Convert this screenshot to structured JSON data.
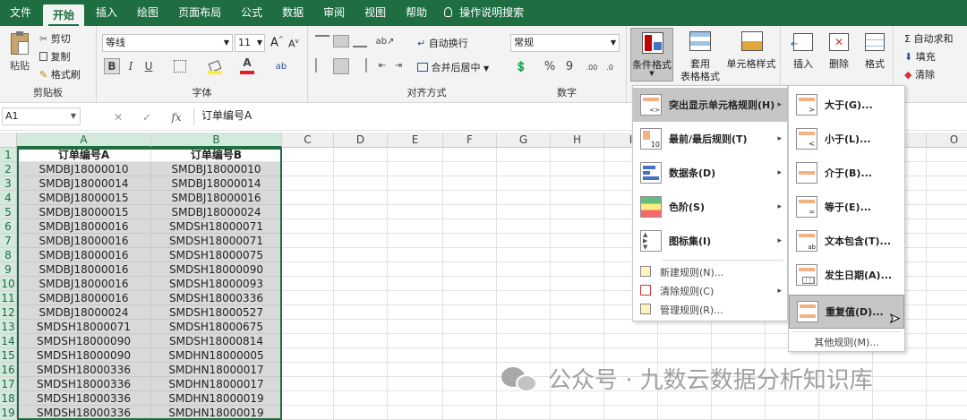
{
  "menubar": {
    "tabs": [
      "文件",
      "开始",
      "插入",
      "绘图",
      "页面布局",
      "公式",
      "数据",
      "审阅",
      "视图",
      "帮助"
    ],
    "active": "开始",
    "tell_me": "操作说明搜索"
  },
  "ribbon": {
    "clipboard": {
      "paste": "粘贴",
      "cut": "剪切",
      "copy": "复制",
      "painter": "格式刷",
      "label": "剪贴板"
    },
    "font": {
      "name": "等线",
      "size": "11",
      "bold": "B",
      "italic": "I",
      "underline": "U",
      "grow": "A",
      "shrink": "A",
      "label": "字体"
    },
    "alignment": {
      "wrap": "自动换行",
      "merge": "合并后居中",
      "label": "对齐方式"
    },
    "number": {
      "format": "常规",
      "percent": "%",
      "comma": "9",
      "label": "数字"
    },
    "styles": {
      "conditional": "条件格式",
      "table_l1": "套用",
      "table_l2": "表格格式",
      "cell_styles": "单元格样式"
    },
    "cells": {
      "insert": "插入",
      "delete": "删除",
      "format": "格式"
    },
    "editing": {
      "autosum": "Σ 自动求和",
      "fill": "填充",
      "clear": "清除"
    }
  },
  "formula_bar": {
    "name_box": "A1",
    "cancel": "✕",
    "enter": "✓",
    "fx": "fx",
    "content": "订单编号A"
  },
  "grid": {
    "columns": [
      "A",
      "B",
      "C",
      "D",
      "E",
      "F",
      "G",
      "H",
      "I",
      "J",
      "K",
      "L",
      "M",
      "N",
      "O"
    ],
    "rows": [
      "1",
      "2",
      "3",
      "4",
      "5",
      "6",
      "7",
      "8",
      "9",
      "10",
      "11",
      "12",
      "13",
      "14",
      "15",
      "16",
      "17",
      "18",
      "19"
    ],
    "header": [
      "订单编号A",
      "订单编号B"
    ],
    "data": [
      [
        "SMDBJ18000010",
        "SMDBJ18000010"
      ],
      [
        "SMDBJ18000014",
        "SMDBJ18000014"
      ],
      [
        "SMDBJ18000015",
        "SMDBJ18000016"
      ],
      [
        "SMDBJ18000015",
        "SMDBJ18000024"
      ],
      [
        "SMDBJ18000016",
        "SMDSH18000071"
      ],
      [
        "SMDBJ18000016",
        "SMDSH18000071"
      ],
      [
        "SMDBJ18000016",
        "SMDSH18000075"
      ],
      [
        "SMDBJ18000016",
        "SMDSH18000090"
      ],
      [
        "SMDBJ18000016",
        "SMDSH18000093"
      ],
      [
        "SMDBJ18000016",
        "SMDSH18000336"
      ],
      [
        "SMDBJ18000024",
        "SMDSH18000527"
      ],
      [
        "SMDSH18000071",
        "SMDSH18000675"
      ],
      [
        "SMDSH18000090",
        "SMDSH18000814"
      ],
      [
        "SMDSH18000090",
        "SMDHN18000005"
      ],
      [
        "SMDSH18000336",
        "SMDHN18000017"
      ],
      [
        "SMDSH18000336",
        "SMDHN18000017"
      ],
      [
        "SMDSH18000336",
        "SMDHN18000019"
      ],
      [
        "SMDSH18000336",
        "SMDHN18000019"
      ]
    ]
  },
  "cf_menu": {
    "items": [
      {
        "label": "突出显示单元格规则(H)",
        "has_sub": true
      },
      {
        "label": "最前/最后规则(T)",
        "has_sub": true
      },
      {
        "label": "数据条(D)",
        "has_sub": true
      },
      {
        "label": "色阶(S)",
        "has_sub": true
      },
      {
        "label": "图标集(I)",
        "has_sub": true
      }
    ],
    "actions": [
      {
        "label": "新建规则(N)..."
      },
      {
        "label": "清除规则(C)",
        "has_sub": true
      },
      {
        "label": "管理规则(R)..."
      }
    ]
  },
  "sub_menu": {
    "items": [
      "大于(G)...",
      "小于(L)...",
      "介于(B)...",
      "等于(E)...",
      "文本包含(T)...",
      "发生日期(A)...",
      "重复值(D)..."
    ],
    "other": "其他规则(M)..."
  },
  "watermark": "公众号 · 九数云数据分析知识库",
  "colors": {
    "excel_green": "#1e6e42",
    "selected_fill": "#d9d9d9",
    "highlight": "#c6c6c6"
  }
}
